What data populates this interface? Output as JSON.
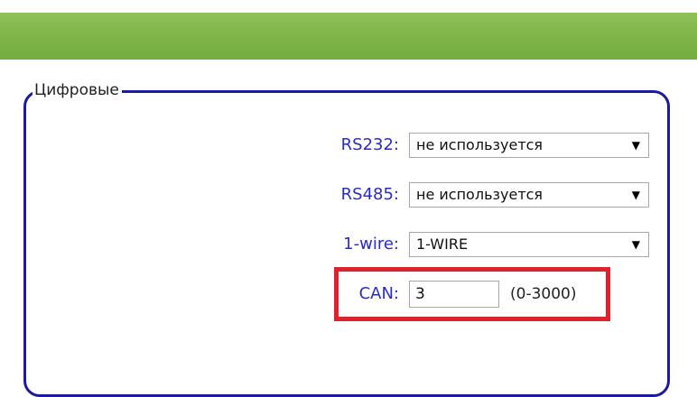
{
  "section": {
    "legend": "Цифровые"
  },
  "fields": {
    "rs232": {
      "label": "RS232:",
      "value": "не используется",
      "arrow": "▼"
    },
    "rs485": {
      "label": "RS485:",
      "value": "не используется",
      "arrow": "▼"
    },
    "onewire": {
      "label": "1-wire:",
      "value": "1-WIRE",
      "arrow": "▼"
    },
    "can": {
      "label": "CAN:",
      "value": "3",
      "range": "(0-3000)"
    }
  },
  "colors": {
    "header_green": "#7db447",
    "fieldset_border": "#1a1aa6",
    "label_blue": "#2a2ac8",
    "highlight_red": "#e0202b"
  }
}
